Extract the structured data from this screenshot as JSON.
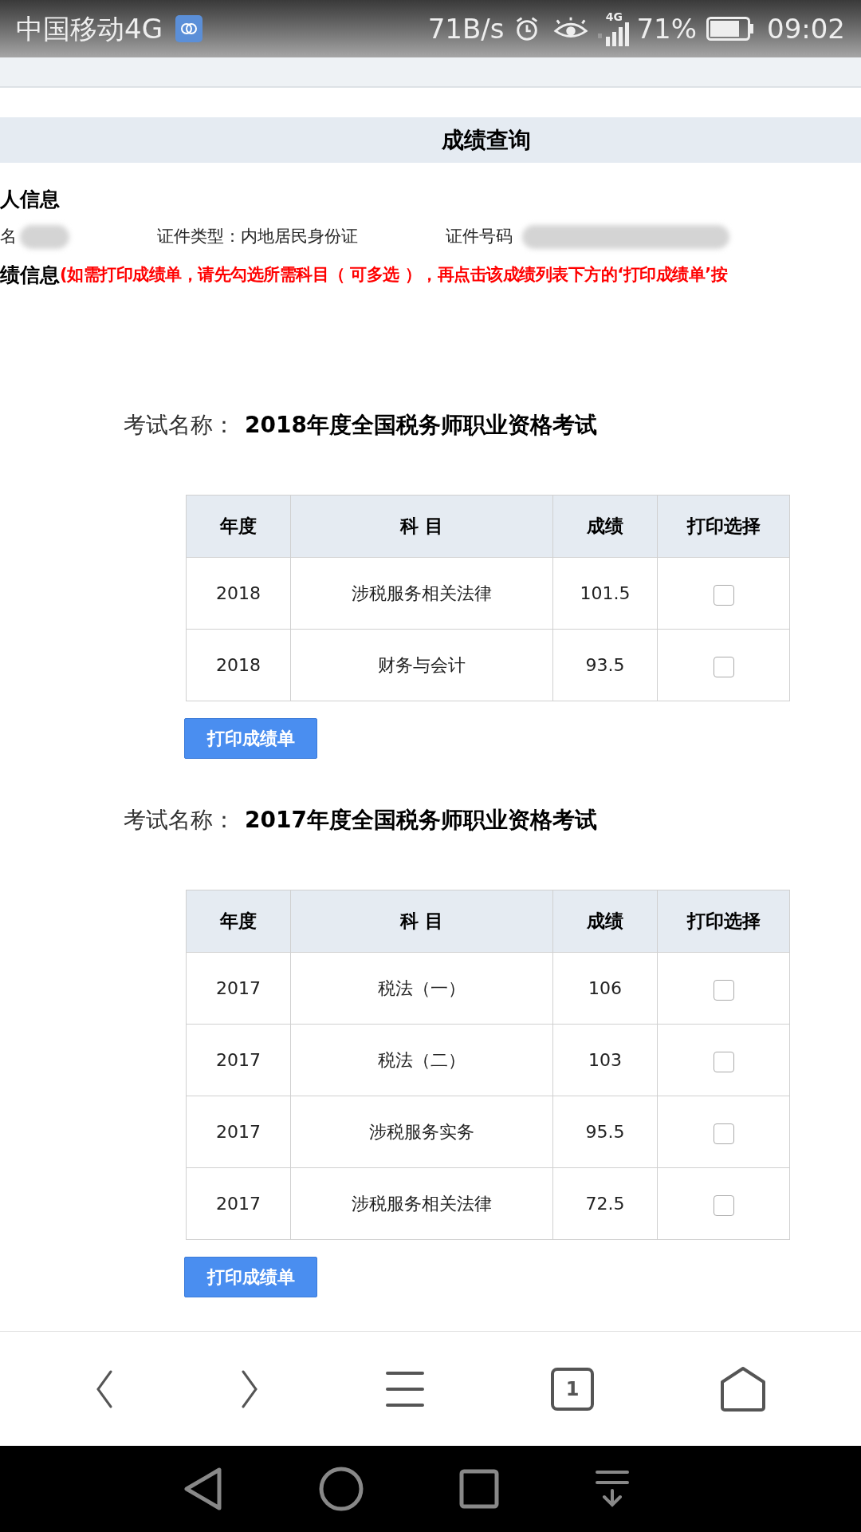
{
  "status_bar": {
    "carrier": "中国移动4G",
    "speed": "71B/s",
    "network": "4G",
    "battery": "71%",
    "time": "09:02"
  },
  "page_title": "成绩查询",
  "personal_section": {
    "heading": "人信息",
    "name_label": "名",
    "id_type": "证件类型：内地居民身份证",
    "id_number_label": "证件号码"
  },
  "score_section": {
    "heading": "绩信息",
    "notice": "(如需打印成绩单，请先勾选所需科目（ 可多选 ），再点击该成绩列表下方的‘打印成绩单’按"
  },
  "exams": [
    {
      "label": "考试名称：",
      "name": "2018年度全国税务师职业资格考试",
      "columns": [
        "年度",
        "科 目",
        "成绩",
        "打印选择"
      ],
      "rows": [
        {
          "year": "2018",
          "subject": "涉税服务相关法律",
          "score": "101.5",
          "checked": false
        },
        {
          "year": "2018",
          "subject": "财务与会计",
          "score": "93.5",
          "checked": false
        }
      ],
      "print_button": "打印成绩单"
    },
    {
      "label": "考试名称：",
      "name": "2017年度全国税务师职业资格考试",
      "columns": [
        "年度",
        "科 目",
        "成绩",
        "打印选择"
      ],
      "rows": [
        {
          "year": "2017",
          "subject": "税法（一）",
          "score": "106",
          "checked": false
        },
        {
          "year": "2017",
          "subject": "税法（二）",
          "score": "103",
          "checked": false
        },
        {
          "year": "2017",
          "subject": "涉税服务实务",
          "score": "95.5",
          "checked": false
        },
        {
          "year": "2017",
          "subject": "涉税服务相关法律",
          "score": "72.5",
          "checked": false
        }
      ],
      "print_button": "打印成绩单"
    }
  ],
  "browser_toolbar": {
    "tab_count": "1"
  }
}
